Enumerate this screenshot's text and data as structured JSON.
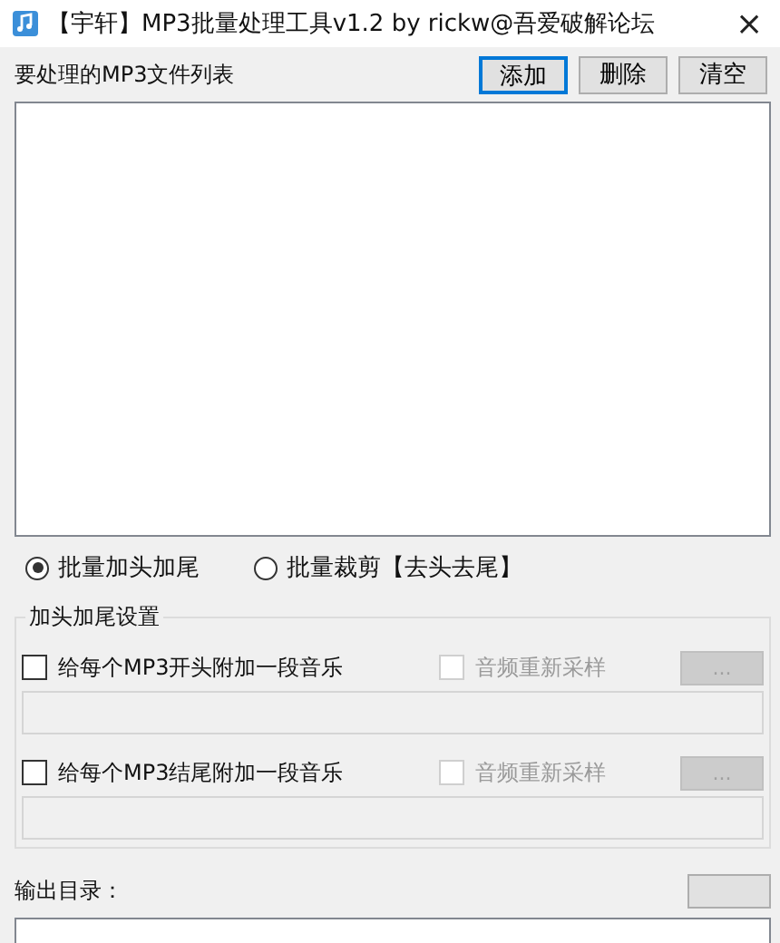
{
  "window": {
    "title": "【宇轩】MP3批量处理工具v1.2  by rickw@吾爱破解论坛",
    "close": "×"
  },
  "file_list": {
    "label": "要处理的MP3文件列表"
  },
  "buttons": [
    {
      "label": "添加",
      "focused": true
    },
    {
      "label": "删除",
      "focused": false
    },
    {
      "label": "清空",
      "focused": false
    }
  ],
  "modes": [
    {
      "label": "批量加头加尾",
      "selected": true
    },
    {
      "label": "批量裁剪【去头去尾】",
      "selected": false
    }
  ],
  "group": {
    "title": "加头加尾设置",
    "rows": [
      {
        "label": "给每个MP3开头附加一段音乐",
        "checked": false,
        "resample": {
          "label": "音频重新采样",
          "checked": false,
          "disabled": true
        },
        "browse": {
          "label": "...",
          "disabled": true
        }
      },
      {
        "label": "给每个MP3结尾附加一段音乐",
        "checked": false,
        "resample": {
          "label": "音频重新采样",
          "checked": false,
          "disabled": true
        },
        "browse": {
          "label": "...",
          "disabled": true
        }
      }
    ]
  },
  "output": {
    "label": "输出目录："
  }
}
